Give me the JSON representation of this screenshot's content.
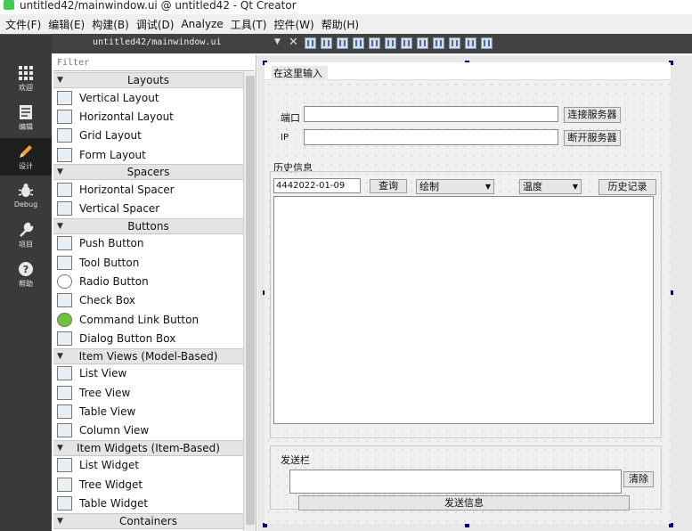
{
  "window": {
    "title": "untitled42/mainwindow.ui @ untitled42 - Qt Creator"
  },
  "menu": [
    "文件(F)",
    "编辑(E)",
    "构建(B)",
    "调试(D)",
    "Analyze",
    "工具(T)",
    "控件(W)",
    "帮助(H)"
  ],
  "modes": [
    {
      "label": "欢迎",
      "icon": "grid-icon"
    },
    {
      "label": "编辑",
      "icon": "edit-doc-icon"
    },
    {
      "label": "设计",
      "icon": "pencil-icon"
    },
    {
      "label": "Debug",
      "icon": "bug-icon"
    },
    {
      "label": "项目",
      "icon": "wrench-icon"
    },
    {
      "label": "帮助",
      "icon": "help-icon"
    }
  ],
  "editor": {
    "document": "untitled42/mainwindow.ui",
    "dropdown": "▼",
    "close": "✕"
  },
  "widgetbox": {
    "filter_placeholder": "Filter",
    "sections": [
      {
        "title": "Layouts",
        "items": [
          "Vertical Layout",
          "Horizontal Layout",
          "Grid Layout",
          "Form Layout"
        ]
      },
      {
        "title": "Spacers",
        "items": [
          "Horizontal Spacer",
          "Vertical Spacer"
        ]
      },
      {
        "title": "Buttons",
        "items": [
          "Push Button",
          "Tool Button",
          "Radio Button",
          "Check Box",
          "Command Link Button",
          "Dialog Button Box"
        ]
      },
      {
        "title": "Item Views (Model-Based)",
        "items": [
          "List View",
          "Tree View",
          "Table View",
          "Column View"
        ]
      },
      {
        "title": "Item Widgets (Item-Based)",
        "items": [
          "List Widget",
          "Tree Widget",
          "Table Widget"
        ]
      },
      {
        "title": "Containers",
        "items": []
      }
    ]
  },
  "form": {
    "menubar_text": "在这里输入",
    "port_label": "端口",
    "ip_label": "IP",
    "connect_button": "连接服务器",
    "disconnect_button": "断开服务器",
    "history_group": "历史信息",
    "date_value": "4442022-01-09",
    "query_button": "查询",
    "plot_combo": "绘制",
    "temp_combo": "温度",
    "history_button": "历史记录",
    "send_group": "发送栏",
    "clear_button": "清除",
    "send_button": "发送信息"
  }
}
